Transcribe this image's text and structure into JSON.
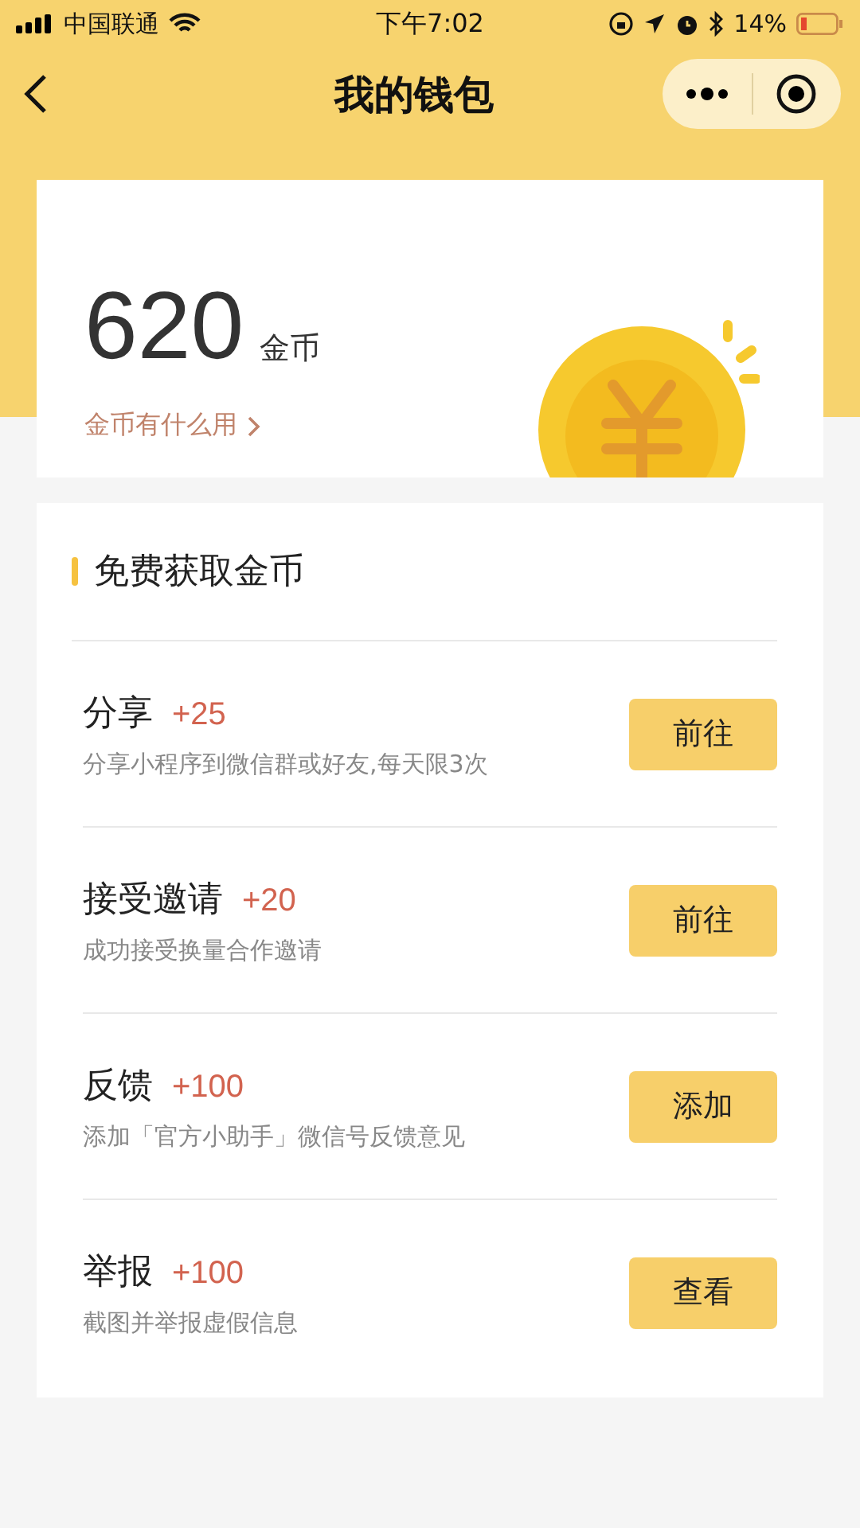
{
  "status_bar": {
    "carrier": "中国联通",
    "time": "下午7:02",
    "battery": "14%"
  },
  "nav": {
    "title": "我的钱包"
  },
  "balance": {
    "amount": "620",
    "unit": "金币",
    "link": "金币有什么用"
  },
  "tasks": {
    "title": "免费获取金币",
    "items": [
      {
        "name": "分享",
        "reward": "+25",
        "desc": "分享小程序到微信群或好友,每天限3次",
        "action": "前往"
      },
      {
        "name": "接受邀请",
        "reward": "+20",
        "desc": "成功接受换量合作邀请",
        "action": "前往"
      },
      {
        "name": "反馈",
        "reward": "+100",
        "desc": "添加「官方小助手」微信号反馈意见",
        "action": "添加"
      },
      {
        "name": "举报",
        "reward": "+100",
        "desc": "截图并举报虚假信息",
        "action": "查看"
      }
    ]
  }
}
